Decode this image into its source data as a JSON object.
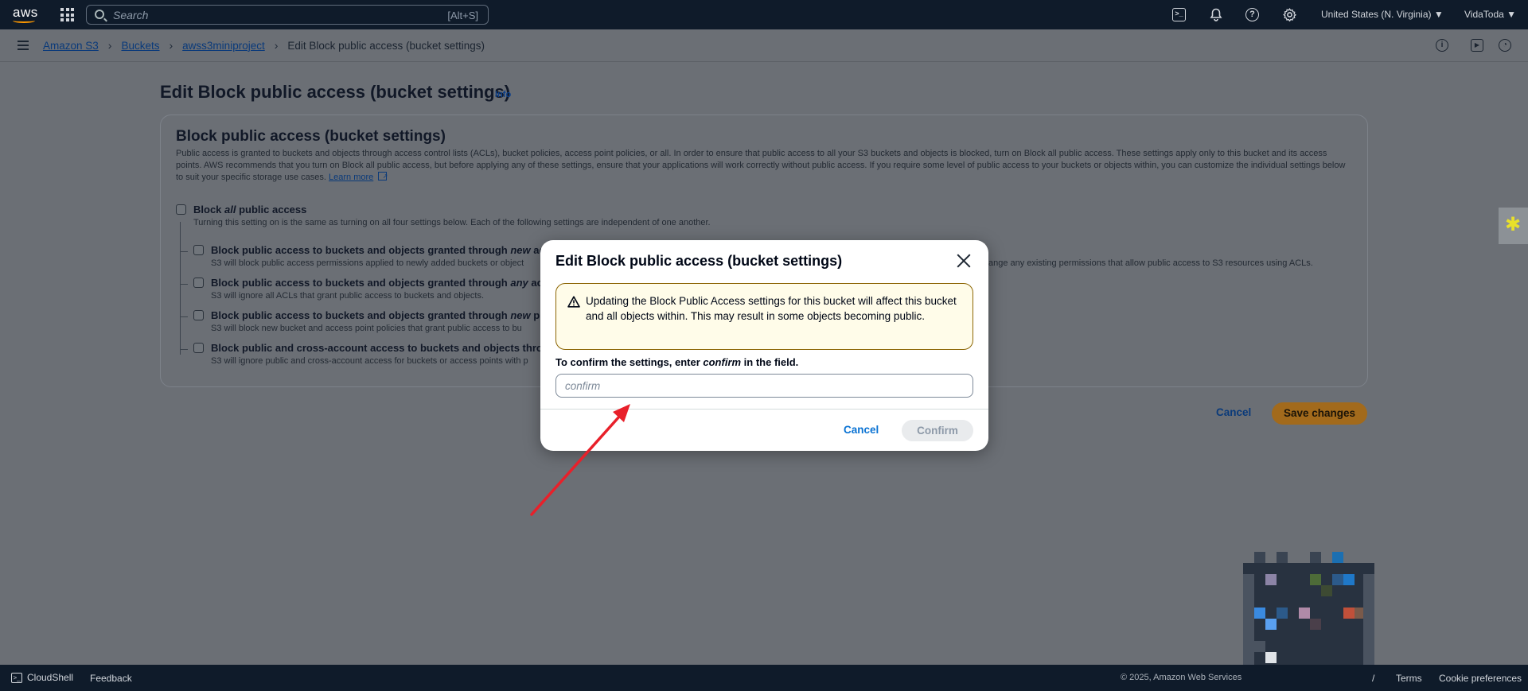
{
  "topnav": {
    "logo_text": "aws",
    "search_placeholder": "Search",
    "search_shortcut": "[Alt+S]",
    "region": "United States (N. Virginia) ▼",
    "user": "VidaToda ▼"
  },
  "breadcrumbs": {
    "items": [
      "Amazon S3",
      "Buckets",
      "awss3miniproject"
    ],
    "current": "Edit Block public access (bucket settings)"
  },
  "page": {
    "title": "Edit Block public access (bucket settings)",
    "info": "Info",
    "panel_title": "Block public access (bucket settings)",
    "panel_description": "Public access is granted to buckets and objects through access control lists (ACLs), bucket policies, access point policies, or all. In order to ensure that public access to all your S3 buckets and objects is blocked, turn on Block all public access. These settings apply only to this bucket and its access points. AWS recommends that you turn on Block all public access, but before applying any of these settings, ensure that your applications will work correctly without public access. If you require some level of public access to your buckets or objects within, you can customize the individual settings below to suit your specific storage use cases.",
    "learn_more": "Learn more",
    "block_all": {
      "label_pre": "Block ",
      "label_em": "all",
      "label_post": " public access",
      "description": "Turning this setting on is the same as turning on all four settings below. Each of the following settings are independent of one another."
    },
    "options": [
      {
        "label_pre": "Block public access to buckets and objects granted through ",
        "label_em": "new",
        "label_post": " acc",
        "description": "S3 will block public access permissions applied to newly added buckets or object",
        "description_tail": "ange any existing permissions that allow public access to S3 resources using ACLs."
      },
      {
        "label_pre": "Block public access to buckets and objects granted through ",
        "label_em": "any",
        "label_post": " acc",
        "description": "S3 will ignore all ACLs that grant public access to buckets and objects."
      },
      {
        "label_pre": "Block public access to buckets and objects granted through ",
        "label_em": "new",
        "label_post": " pul",
        "description": "S3 will block new bucket and access point policies that grant public access to bu"
      },
      {
        "label_pre": "Block public and cross-account access to buckets and objects throu",
        "label_em": "",
        "label_post": "",
        "description": "S3 will ignore public and cross-account access for buckets or access points with p"
      }
    ],
    "cancel": "Cancel",
    "save": "Save changes"
  },
  "modal": {
    "title": "Edit Block public access (bucket settings)",
    "warning": "Updating the Block Public Access settings for this bucket will affect this bucket and all objects within. This may result in some objects becoming public.",
    "confirm_label_pre": "To confirm the settings, enter ",
    "confirm_label_em": "confirm",
    "confirm_label_post": " in the field.",
    "input_placeholder": "confirm",
    "input_value": "",
    "cancel": "Cancel",
    "confirm": "Confirm"
  },
  "footer": {
    "cloudshell": "CloudShell",
    "feedback": "Feedback",
    "copyright": "© 2025, Amazon Web Services",
    "privacy": "/",
    "terms": "Terms",
    "cookies": "Cookie preferences"
  },
  "colors": {
    "nav_bg": "#0f1b2a",
    "overlay": "#6b6f75",
    "primary_link": "#0972d3",
    "warning_border": "#8d6605",
    "warning_bg": "#fffce9",
    "annotation_arrow": "#e8202a"
  },
  "icons": [
    "grid-icon",
    "search-icon",
    "cloudshell-icon",
    "bell-icon",
    "help-icon",
    "gear-icon",
    "close-icon",
    "warning-icon",
    "external-link-icon",
    "info-icon"
  ]
}
